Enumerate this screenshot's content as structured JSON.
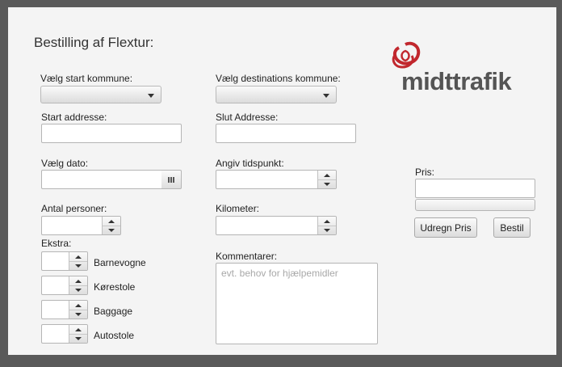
{
  "form": {
    "title": "Bestilling af Flextur:",
    "start_kommune_label": "Vælg start kommune:",
    "destination_kommune_label": "Vælg destinations kommune:",
    "start_address_label": "Start addresse:",
    "slut_address_label": "Slut Addresse:",
    "date_label": "Vælg dato:",
    "time_label": "Angiv tidspunkt:",
    "persons_label": "Antal personer:",
    "km_label": "Kilometer:",
    "extra_label": "Ekstra:",
    "comments_label": "Kommentarer:",
    "comments_placeholder": "evt. behov for hjælpemidler",
    "extras": [
      {
        "label": "Barnevogne"
      },
      {
        "label": "Kørestole"
      },
      {
        "label": "Baggage"
      },
      {
        "label": "Autostole"
      }
    ]
  },
  "price": {
    "label": "Pris:",
    "calc_button": "Udregn Pris",
    "order_button": "Bestil"
  },
  "logo": {
    "text": "midttrafik",
    "color": "#c1272d"
  }
}
